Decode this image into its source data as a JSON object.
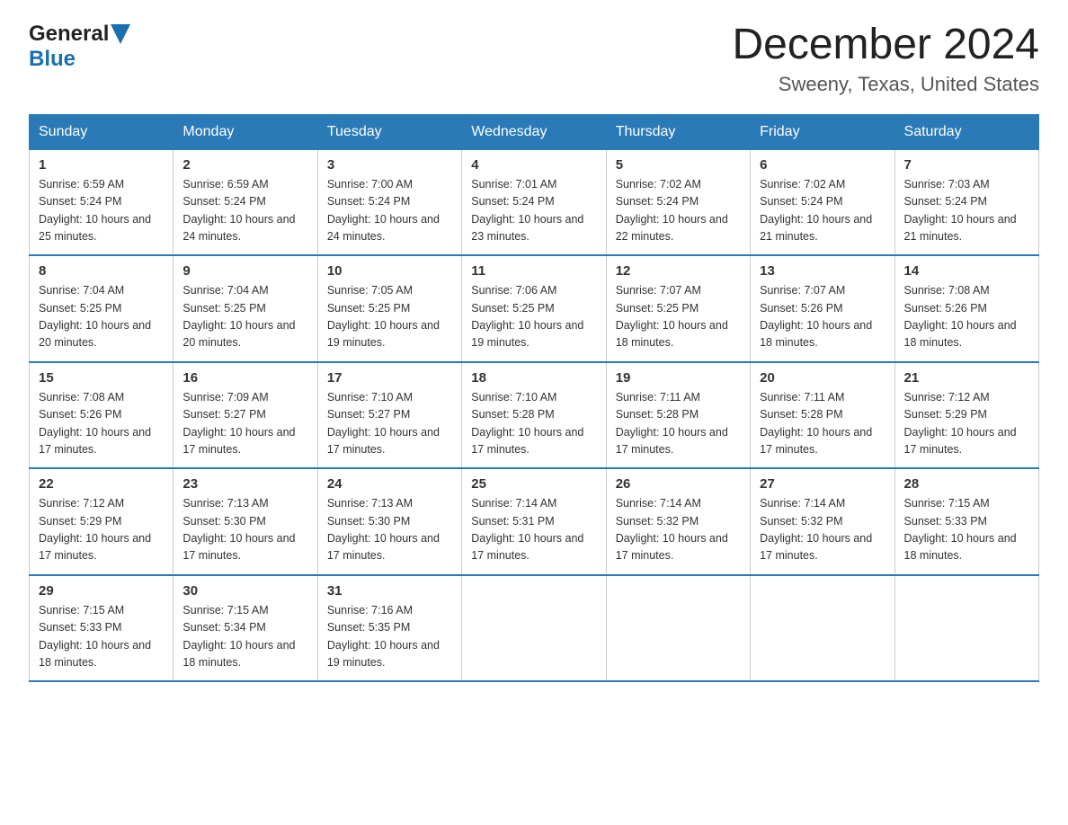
{
  "logo": {
    "text_general": "General",
    "text_blue": "Blue"
  },
  "title": {
    "month_year": "December 2024",
    "location": "Sweeny, Texas, United States"
  },
  "days_of_week": [
    "Sunday",
    "Monday",
    "Tuesday",
    "Wednesday",
    "Thursday",
    "Friday",
    "Saturday"
  ],
  "weeks": [
    [
      {
        "day": "1",
        "sunrise": "6:59 AM",
        "sunset": "5:24 PM",
        "daylight": "10 hours and 25 minutes."
      },
      {
        "day": "2",
        "sunrise": "6:59 AM",
        "sunset": "5:24 PM",
        "daylight": "10 hours and 24 minutes."
      },
      {
        "day": "3",
        "sunrise": "7:00 AM",
        "sunset": "5:24 PM",
        "daylight": "10 hours and 24 minutes."
      },
      {
        "day": "4",
        "sunrise": "7:01 AM",
        "sunset": "5:24 PM",
        "daylight": "10 hours and 23 minutes."
      },
      {
        "day": "5",
        "sunrise": "7:02 AM",
        "sunset": "5:24 PM",
        "daylight": "10 hours and 22 minutes."
      },
      {
        "day": "6",
        "sunrise": "7:02 AM",
        "sunset": "5:24 PM",
        "daylight": "10 hours and 21 minutes."
      },
      {
        "day": "7",
        "sunrise": "7:03 AM",
        "sunset": "5:24 PM",
        "daylight": "10 hours and 21 minutes."
      }
    ],
    [
      {
        "day": "8",
        "sunrise": "7:04 AM",
        "sunset": "5:25 PM",
        "daylight": "10 hours and 20 minutes."
      },
      {
        "day": "9",
        "sunrise": "7:04 AM",
        "sunset": "5:25 PM",
        "daylight": "10 hours and 20 minutes."
      },
      {
        "day": "10",
        "sunrise": "7:05 AM",
        "sunset": "5:25 PM",
        "daylight": "10 hours and 19 minutes."
      },
      {
        "day": "11",
        "sunrise": "7:06 AM",
        "sunset": "5:25 PM",
        "daylight": "10 hours and 19 minutes."
      },
      {
        "day": "12",
        "sunrise": "7:07 AM",
        "sunset": "5:25 PM",
        "daylight": "10 hours and 18 minutes."
      },
      {
        "day": "13",
        "sunrise": "7:07 AM",
        "sunset": "5:26 PM",
        "daylight": "10 hours and 18 minutes."
      },
      {
        "day": "14",
        "sunrise": "7:08 AM",
        "sunset": "5:26 PM",
        "daylight": "10 hours and 18 minutes."
      }
    ],
    [
      {
        "day": "15",
        "sunrise": "7:08 AM",
        "sunset": "5:26 PM",
        "daylight": "10 hours and 17 minutes."
      },
      {
        "day": "16",
        "sunrise": "7:09 AM",
        "sunset": "5:27 PM",
        "daylight": "10 hours and 17 minutes."
      },
      {
        "day": "17",
        "sunrise": "7:10 AM",
        "sunset": "5:27 PM",
        "daylight": "10 hours and 17 minutes."
      },
      {
        "day": "18",
        "sunrise": "7:10 AM",
        "sunset": "5:28 PM",
        "daylight": "10 hours and 17 minutes."
      },
      {
        "day": "19",
        "sunrise": "7:11 AM",
        "sunset": "5:28 PM",
        "daylight": "10 hours and 17 minutes."
      },
      {
        "day": "20",
        "sunrise": "7:11 AM",
        "sunset": "5:28 PM",
        "daylight": "10 hours and 17 minutes."
      },
      {
        "day": "21",
        "sunrise": "7:12 AM",
        "sunset": "5:29 PM",
        "daylight": "10 hours and 17 minutes."
      }
    ],
    [
      {
        "day": "22",
        "sunrise": "7:12 AM",
        "sunset": "5:29 PM",
        "daylight": "10 hours and 17 minutes."
      },
      {
        "day": "23",
        "sunrise": "7:13 AM",
        "sunset": "5:30 PM",
        "daylight": "10 hours and 17 minutes."
      },
      {
        "day": "24",
        "sunrise": "7:13 AM",
        "sunset": "5:30 PM",
        "daylight": "10 hours and 17 minutes."
      },
      {
        "day": "25",
        "sunrise": "7:14 AM",
        "sunset": "5:31 PM",
        "daylight": "10 hours and 17 minutes."
      },
      {
        "day": "26",
        "sunrise": "7:14 AM",
        "sunset": "5:32 PM",
        "daylight": "10 hours and 17 minutes."
      },
      {
        "day": "27",
        "sunrise": "7:14 AM",
        "sunset": "5:32 PM",
        "daylight": "10 hours and 17 minutes."
      },
      {
        "day": "28",
        "sunrise": "7:15 AM",
        "sunset": "5:33 PM",
        "daylight": "10 hours and 18 minutes."
      }
    ],
    [
      {
        "day": "29",
        "sunrise": "7:15 AM",
        "sunset": "5:33 PM",
        "daylight": "10 hours and 18 minutes."
      },
      {
        "day": "30",
        "sunrise": "7:15 AM",
        "sunset": "5:34 PM",
        "daylight": "10 hours and 18 minutes."
      },
      {
        "day": "31",
        "sunrise": "7:16 AM",
        "sunset": "5:35 PM",
        "daylight": "10 hours and 19 minutes."
      },
      null,
      null,
      null,
      null
    ]
  ],
  "labels": {
    "sunrise": "Sunrise: ",
    "sunset": "Sunset: ",
    "daylight": "Daylight: "
  }
}
